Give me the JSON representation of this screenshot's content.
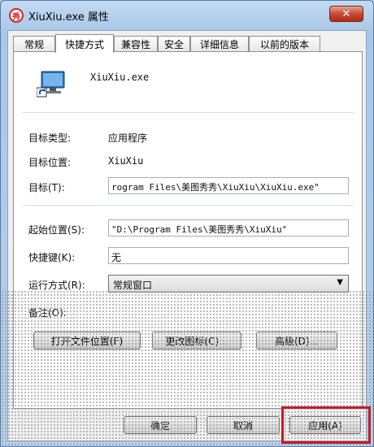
{
  "window": {
    "title": "XiuXiu.exe 属性",
    "app_icon_glyph": "秀",
    "close_glyph": "✕"
  },
  "tabs": [
    {
      "label": "常规"
    },
    {
      "label": "快捷方式"
    },
    {
      "label": "兼容性"
    },
    {
      "label": "安全"
    },
    {
      "label": "详细信息"
    },
    {
      "label": "以前的版本"
    }
  ],
  "header": {
    "file_name": "XiuXiu.exe",
    "icon": "computer-shortcut-icon"
  },
  "props": {
    "target_type_label": "目标类型:",
    "target_type_value": "应用程序",
    "target_location_label": "目标位置:",
    "target_location_value": "XiuXiu",
    "target_label": "目标(T):",
    "target_value": "rogram Files\\美图秀秀\\XiuXiu\\XiuXiu.exe\"",
    "start_in_label": "起始位置(S):",
    "start_in_value": "\"D:\\Program Files\\美图秀秀\\XiuXiu\"",
    "shortcut_key_label": "快捷键(K):",
    "shortcut_key_value": "无",
    "run_label": "运行方式(R):",
    "run_value": "常规窗口",
    "comment_label": "备注(O):"
  },
  "buttons": {
    "open_location": "打开文件位置(F)",
    "change_icon": "更改图标(C)...",
    "advanced": "高级(D)...",
    "ok": "确定",
    "cancel": "取消",
    "apply": "应用(A)"
  },
  "colors": {
    "highlight": "#c41a24",
    "title_bar": "#b6d0ec"
  }
}
